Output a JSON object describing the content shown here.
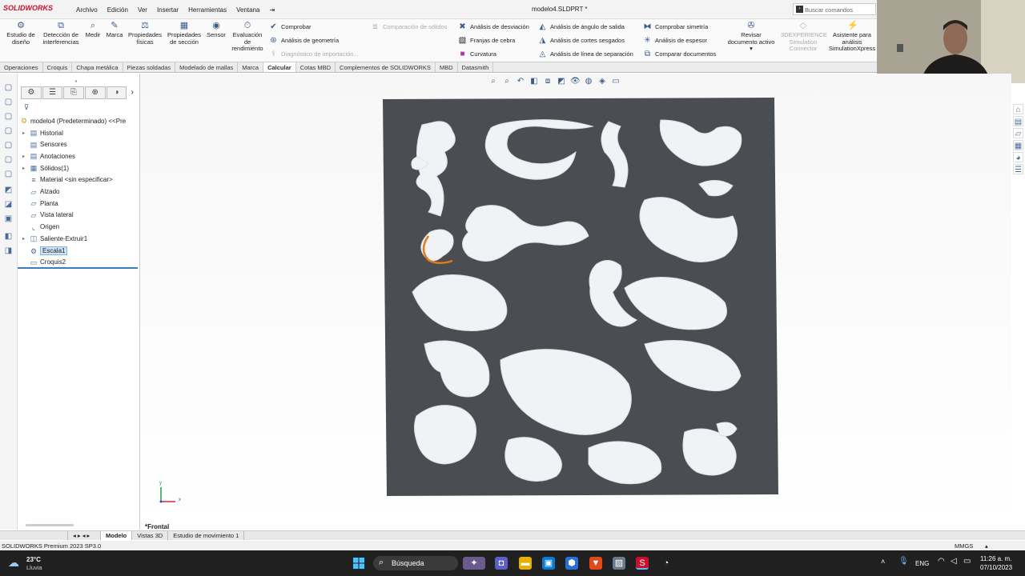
{
  "app": {
    "logo_text": "SOLIDWORKS",
    "document_title": "modelo4.SLDPRT *",
    "search_placeholder": "Buscar comandos"
  },
  "menu": [
    "Archivo",
    "Edición",
    "Ver",
    "Insertar",
    "Herramientas",
    "Ventana"
  ],
  "ribbon": {
    "big_buttons": [
      {
        "label1": "Estudio de",
        "label2": "diseño",
        "icon": "design-study-icon"
      },
      {
        "label1": "Detección de",
        "label2": "interferencias",
        "icon": "interference-icon"
      },
      {
        "label1": "Medir",
        "label2": "",
        "icon": "measure-icon"
      },
      {
        "label1": "Marca",
        "label2": "",
        "icon": "markup-icon"
      },
      {
        "label1": "Propiedades",
        "label2": "físicas",
        "icon": "mass-properties-icon"
      },
      {
        "label1": "Propiedades",
        "label2": "de sección",
        "icon": "section-properties-icon"
      },
      {
        "label1": "Sensor",
        "label2": "",
        "icon": "sensor-icon"
      },
      {
        "label1": "Evaluación",
        "label2": "de",
        "label3": "rendimiento",
        "icon": "performance-icon"
      }
    ],
    "col1": [
      "Comprobar",
      "Análisis de geometría",
      "Diagnóstico de importación..."
    ],
    "compare_solids": "Comparación de sólidos",
    "col2": [
      "Análisis de desviación",
      "Franjas de cebra",
      "Curvatura"
    ],
    "col3": [
      "Análisis de ángulo de salida",
      "Análisis de cortes sesgados",
      "Análisis de línea de separación"
    ],
    "col4": [
      "Comprobar simetría",
      "Análisis de espesor",
      "Comparar documentos"
    ],
    "review": {
      "label1": "Revisar",
      "label2": "documento activo"
    },
    "exp": {
      "label1": "3DEXPERIENCE",
      "label2": "Simulation",
      "label3": "Connector"
    },
    "assistant": {
      "label1": "Asistente para",
      "label2": "análisis",
      "label3": "SimulationXpress"
    }
  },
  "tabs": [
    "Operaciones",
    "Croquis",
    "Chapa metálica",
    "Piezas soldadas",
    "Modelado de mallas",
    "Marca",
    "Calcular",
    "Cotas MBD",
    "Complementos de SOLIDWORKS",
    "MBD",
    "Datasmith"
  ],
  "active_tab": "Calcular",
  "tree": {
    "root": "modelo4 (Predeterminado) <<Pre",
    "items": [
      {
        "label": "Historial",
        "icon": "history-icon",
        "arrow": true
      },
      {
        "label": "Sensores",
        "icon": "sensor-folder-icon",
        "arrow": false
      },
      {
        "label": "Anotaciones",
        "icon": "annotations-icon",
        "arrow": true
      },
      {
        "label": "Sólidos(1)",
        "icon": "solid-bodies-icon",
        "arrow": true
      },
      {
        "label": "Material <sin especificar>",
        "icon": "material-icon",
        "arrow": false
      },
      {
        "label": "Alzado",
        "icon": "plane-icon",
        "arrow": false
      },
      {
        "label": "Planta",
        "icon": "plane-icon",
        "arrow": false
      },
      {
        "label": "Vista lateral",
        "icon": "plane-icon",
        "arrow": false
      },
      {
        "label": "Origen",
        "icon": "origin-icon",
        "arrow": false
      },
      {
        "label": "Saliente-Extruir1",
        "icon": "extrude-icon",
        "arrow": true
      },
      {
        "label": "Escala1",
        "icon": "scale-icon",
        "arrow": false,
        "selected": true
      },
      {
        "label": "Croquis2",
        "icon": "sketch-icon",
        "arrow": false
      }
    ]
  },
  "viewport": {
    "view_name": "*Frontal",
    "axis_x": "x",
    "axis_y": "y"
  },
  "bottom_tabs": [
    "Modelo",
    "Vistas 3D",
    "Estudio de movimiento 1"
  ],
  "status": {
    "product": "SOLIDWORKS Premium 2023 SP3.0",
    "units": "MMGS"
  },
  "taskbar": {
    "weather_temp": "23°C",
    "weather_desc": "Lluvia",
    "search_label": "Búsqueda",
    "lang": "ENG",
    "time": "11:26 a. m.",
    "date": "07/10/2023"
  },
  "colors": {
    "panel": "#4a4d52",
    "accent": "#3a5a8c",
    "selection": "#cfe3f7"
  }
}
